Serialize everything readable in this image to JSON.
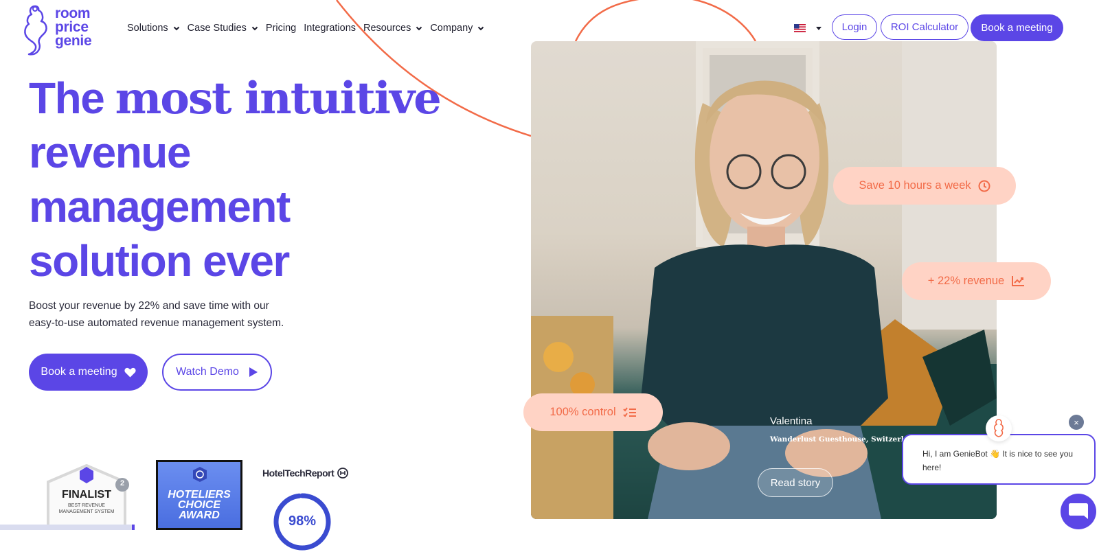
{
  "header": {
    "logo_words": [
      "room",
      "price",
      "genie"
    ],
    "nav": [
      {
        "label": "Solutions",
        "has_dropdown": true
      },
      {
        "label": "Case Studies",
        "has_dropdown": true
      },
      {
        "label": "Pricing",
        "has_dropdown": false
      },
      {
        "label": "Integrations",
        "has_dropdown": false
      },
      {
        "label": "Resources",
        "has_dropdown": true
      },
      {
        "label": "Company",
        "has_dropdown": true
      }
    ],
    "language_icon": "us-flag-icon",
    "login_label": "Login",
    "roi_label": "ROI Calculator",
    "book_label": "Book a meeting"
  },
  "hero": {
    "title_word1": "The",
    "title_word2": "most intuitive",
    "title_line2": "revenue",
    "title_line3": "management",
    "title_line4": "solution ever",
    "subtitle": "Boost your revenue by 22% and save time with our easy-to-use automated revenue management system.",
    "cta_primary": "Book a meeting",
    "cta_secondary": "Watch Demo"
  },
  "awards": {
    "finalist_title": "FINALIST",
    "finalist_sub": "BEST REVENUE MANAGEMENT SYSTEM",
    "finalist_rank": "2",
    "choice_line1": "HOTELIERS",
    "choice_line2": "CHOICE",
    "choice_line3": "AWARD",
    "htr_label": "HotelTechReport",
    "htr_percent": "98%",
    "htr_fraction": 0.98
  },
  "testimonial": {
    "pill_time": "Save 10 hours a week",
    "pill_revenue": "+ 22% revenue",
    "pill_control": "100% control",
    "name": "Valentina",
    "location": "Wanderlust Guesthouse, Switzerland",
    "read_story": "Read story"
  },
  "chatbot": {
    "message": "Hi, I am GenieBot 👋 It is nice to see you here!",
    "close": "×"
  },
  "colors": {
    "brand": "#5b46e6",
    "accent_orange": "#f26b48",
    "pill_bg": "#ffd3c5"
  }
}
